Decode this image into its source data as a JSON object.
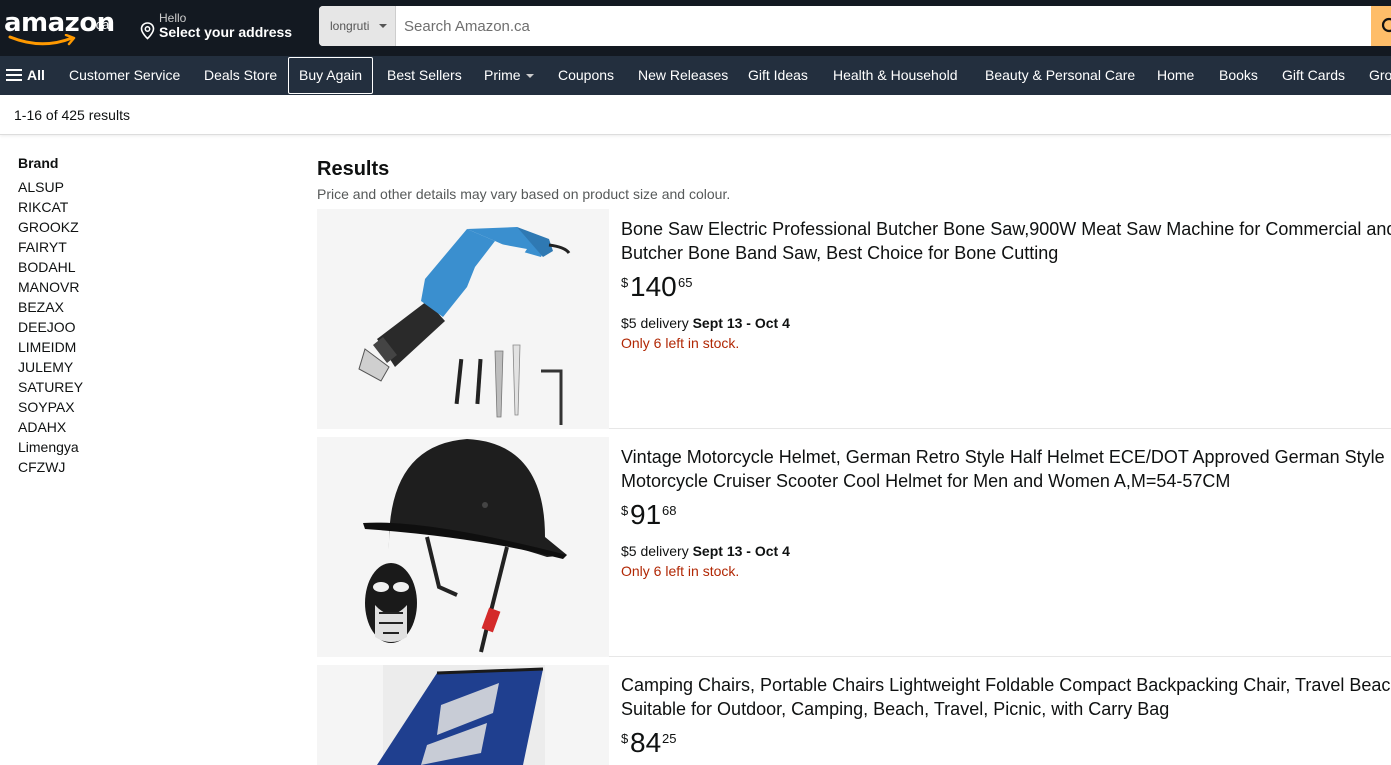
{
  "header": {
    "logo_text": "amazon",
    "logo_tld": ".ca",
    "address_hello": "Hello",
    "address_select": "Select your address",
    "search_department": "longruti",
    "search_placeholder": "Search Amazon.ca"
  },
  "subnav": {
    "all_label": "All",
    "items": [
      "Customer Service",
      "Deals Store",
      "Buy Again",
      "Best Sellers",
      "Prime",
      "Coupons",
      "New Releases",
      "Gift Ideas",
      "Health & Household",
      "Beauty & Personal Care",
      "Home",
      "Books",
      "Gift Cards",
      "Gro"
    ]
  },
  "results_bar": {
    "count_text": "1-16 of 425 results"
  },
  "sidebar": {
    "heading": "Brand",
    "brands": [
      "ALSUP",
      "RIKCAT",
      "GROOKZ",
      "FAIRYT",
      "BODAHL",
      "MANOVR",
      "BEZAX",
      "DEEJOO",
      "LIMEIDM",
      "JULEMY",
      "SATUREY",
      "SOYPAX",
      "ADAHX",
      "Limengya",
      "CFZWJ"
    ]
  },
  "main": {
    "title": "Results",
    "subtitle": "Price and other details may vary based on product size and colour."
  },
  "products": [
    {
      "title_line1": "Bone Saw Electric Professional Butcher Bone Saw,900W Meat Saw Machine for Commercial and",
      "title_line2": "Butcher Bone Band Saw, Best Choice for Bone Cutting",
      "price_symbol": "$",
      "price_whole": "140",
      "price_fraction": "65",
      "delivery_prefix": "$5 delivery",
      "delivery_dates": "Sept 13 - Oct 4",
      "stock": "Only 6 left in stock."
    },
    {
      "title_line1": "Vintage Motorcycle Helmet, German Retro Style Half Helmet ECE/DOT Approved German Style",
      "title_line2": "Motorcycle Cruiser Scooter Cool Helmet for Men and Women A,M=54-57CM",
      "price_symbol": "$",
      "price_whole": "91",
      "price_fraction": "68",
      "delivery_prefix": "$5 delivery",
      "delivery_dates": "Sept 13 - Oct 4",
      "stock": "Only 6 left in stock."
    },
    {
      "title_line1": "Camping Chairs, Portable Chairs Lightweight Foldable Compact Backpacking Chair, Travel Beach",
      "title_line2": "Suitable for Outdoor, Camping, Beach, Travel, Picnic, with Carry Bag",
      "price_symbol": "$",
      "price_whole": "84",
      "price_fraction": "25"
    }
  ],
  "colors": {
    "nav_dark": "#131921",
    "nav_sub": "#232f3e",
    "search_button": "#febd69",
    "logo_smile": "#ff9900",
    "stock_red": "#b12704"
  },
  "icons": {
    "location": "location-pin-icon",
    "search": "magnifier-icon",
    "menu": "hamburger-menu-icon"
  }
}
